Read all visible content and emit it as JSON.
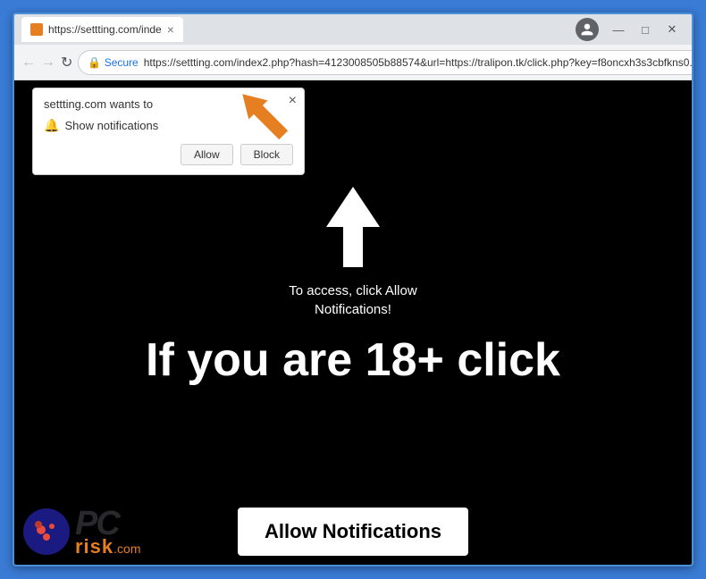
{
  "browser": {
    "tab": {
      "title": "https://settting.com/inde",
      "favicon_color": "#e67e22"
    },
    "address_bar": {
      "secure_label": "Secure",
      "url": "https://settting.com/index2.php?hash=4123008505b88574&url=https://tralipon.tk/click.php?key=f8oncxh3s3cbfkns0..."
    },
    "window_controls": {
      "minimize": "—",
      "maximize": "□",
      "close": "✕"
    }
  },
  "notification_popup": {
    "title": "settting.com wants to",
    "notification_text": "Show notifications",
    "allow_label": "Allow",
    "block_label": "Block",
    "close_label": "×"
  },
  "page_content": {
    "access_text": "To access, click Allow\nNotifications!",
    "age_text": "If you are 18+ click",
    "allow_btn_label": "Allow Notifications"
  },
  "watermark": {
    "pc_text": "PC",
    "risk_text": "risk",
    "com_text": ".com"
  }
}
